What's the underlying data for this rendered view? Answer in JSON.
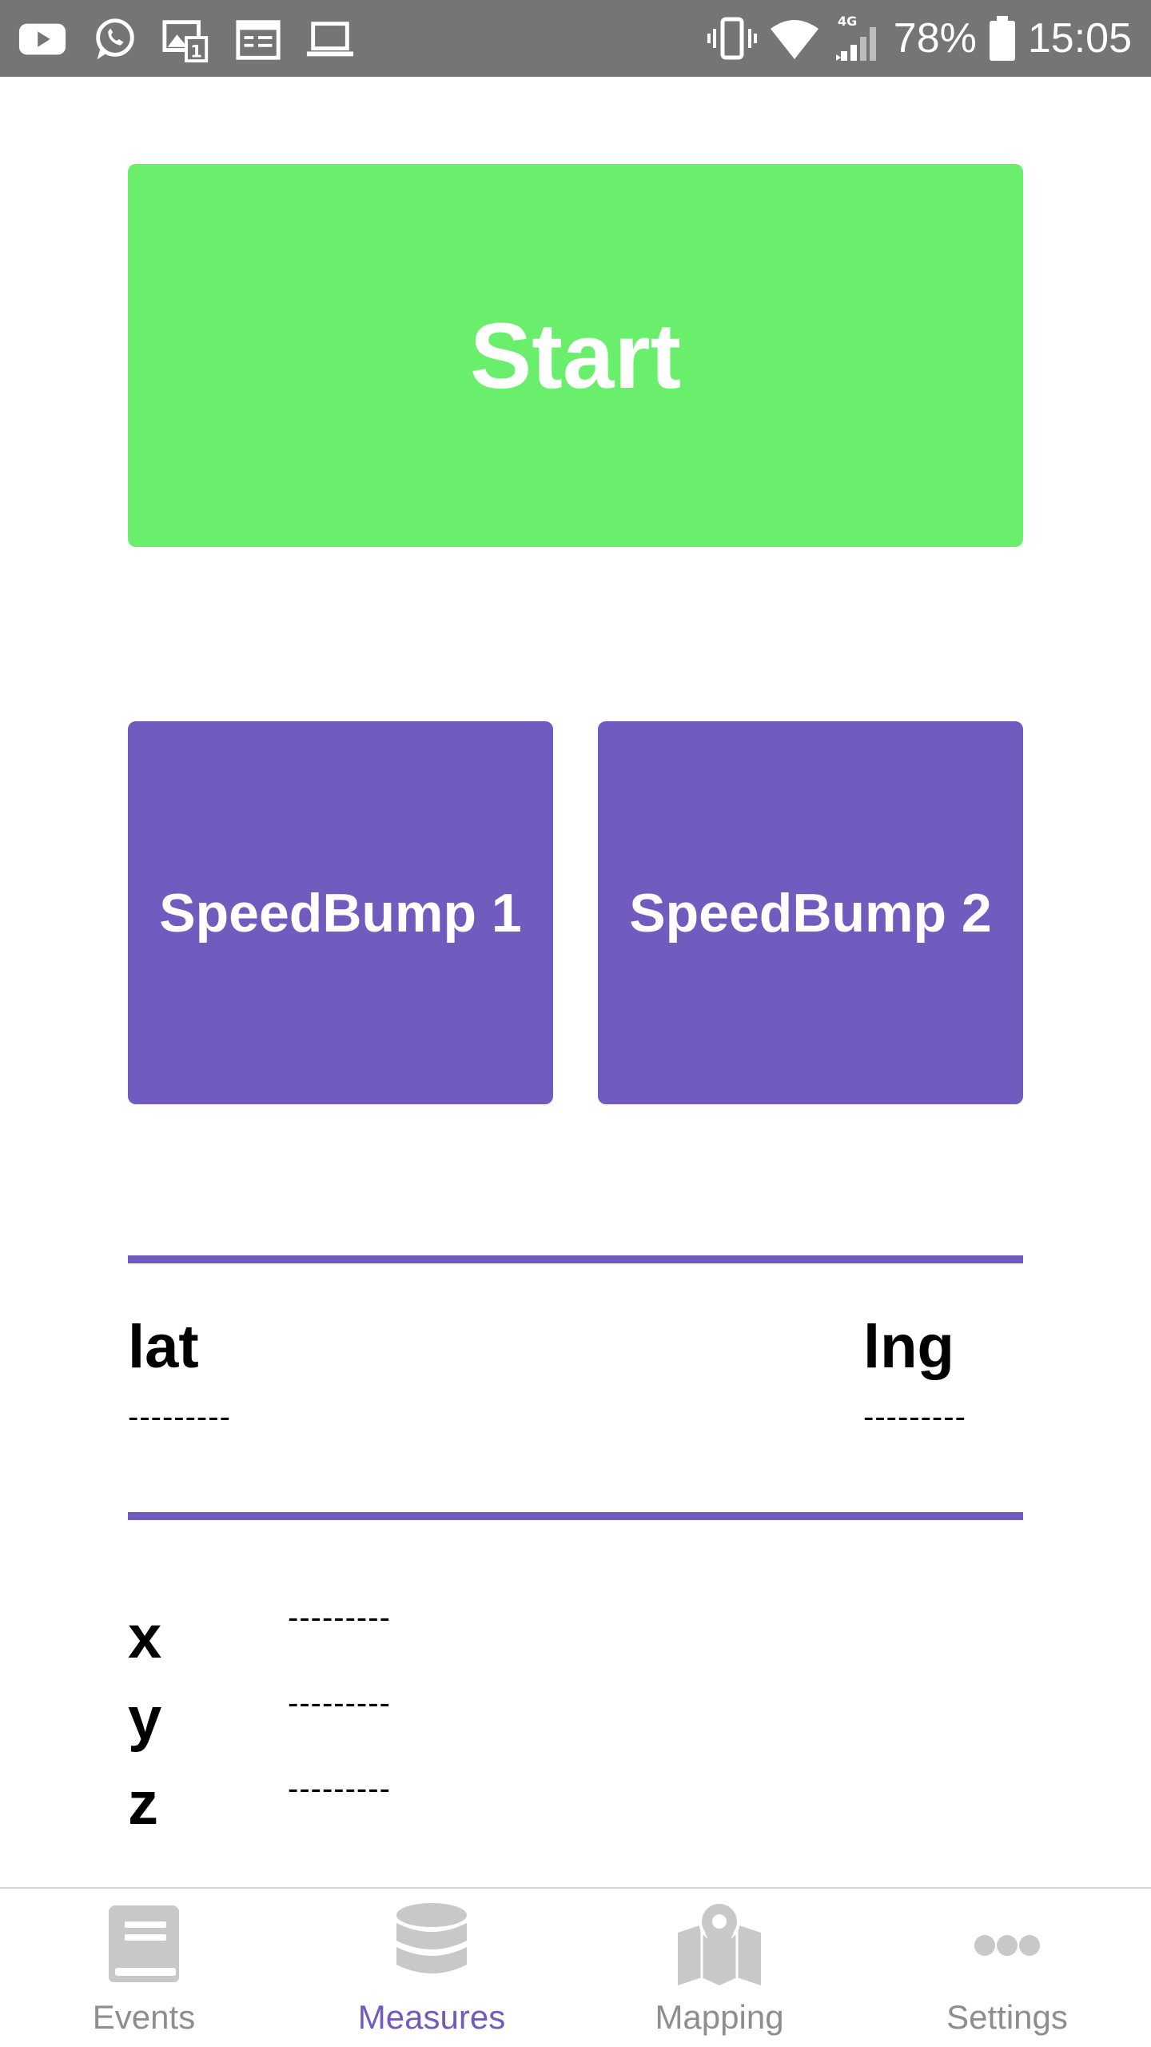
{
  "status_bar": {
    "left_icons": [
      "youtube-icon",
      "whatsapp-icon",
      "photo-notification-icon",
      "calendar-icon",
      "laptop-icon"
    ],
    "right_icons": [
      "vibrate-icon",
      "wifi-icon",
      "cell-signal-4g-icon",
      "battery-icon"
    ],
    "network_label": "4G",
    "battery": "78%",
    "time": "15:05"
  },
  "main": {
    "start_label": "Start",
    "speedbump_1_label": "SpeedBump 1",
    "speedbump_2_label": "SpeedBump 2",
    "location": {
      "lat_label": "lat",
      "lat_value": "---------",
      "lng_label": "lng",
      "lng_value": "---------"
    },
    "accelerometer": {
      "x_label": "x",
      "x_value": "---------",
      "y_label": "y",
      "y_value": "---------",
      "z_label": "z",
      "z_value": "---------"
    }
  },
  "tab_bar": {
    "tabs": [
      {
        "label": "Events",
        "icon": "book-icon",
        "active": false
      },
      {
        "label": "Measures",
        "icon": "database-icon",
        "active": true
      },
      {
        "label": "Mapping",
        "icon": "map-icon",
        "active": false
      },
      {
        "label": "Settings",
        "icon": "more-dots-icon",
        "active": false
      }
    ]
  },
  "colors": {
    "status_bar_bg": "#757575",
    "start_button": "#69ef6b",
    "accent_purple": "#725bbf",
    "tab_inactive": "#8e8e8e",
    "tab_icon_gray": "#c8c8c8"
  }
}
